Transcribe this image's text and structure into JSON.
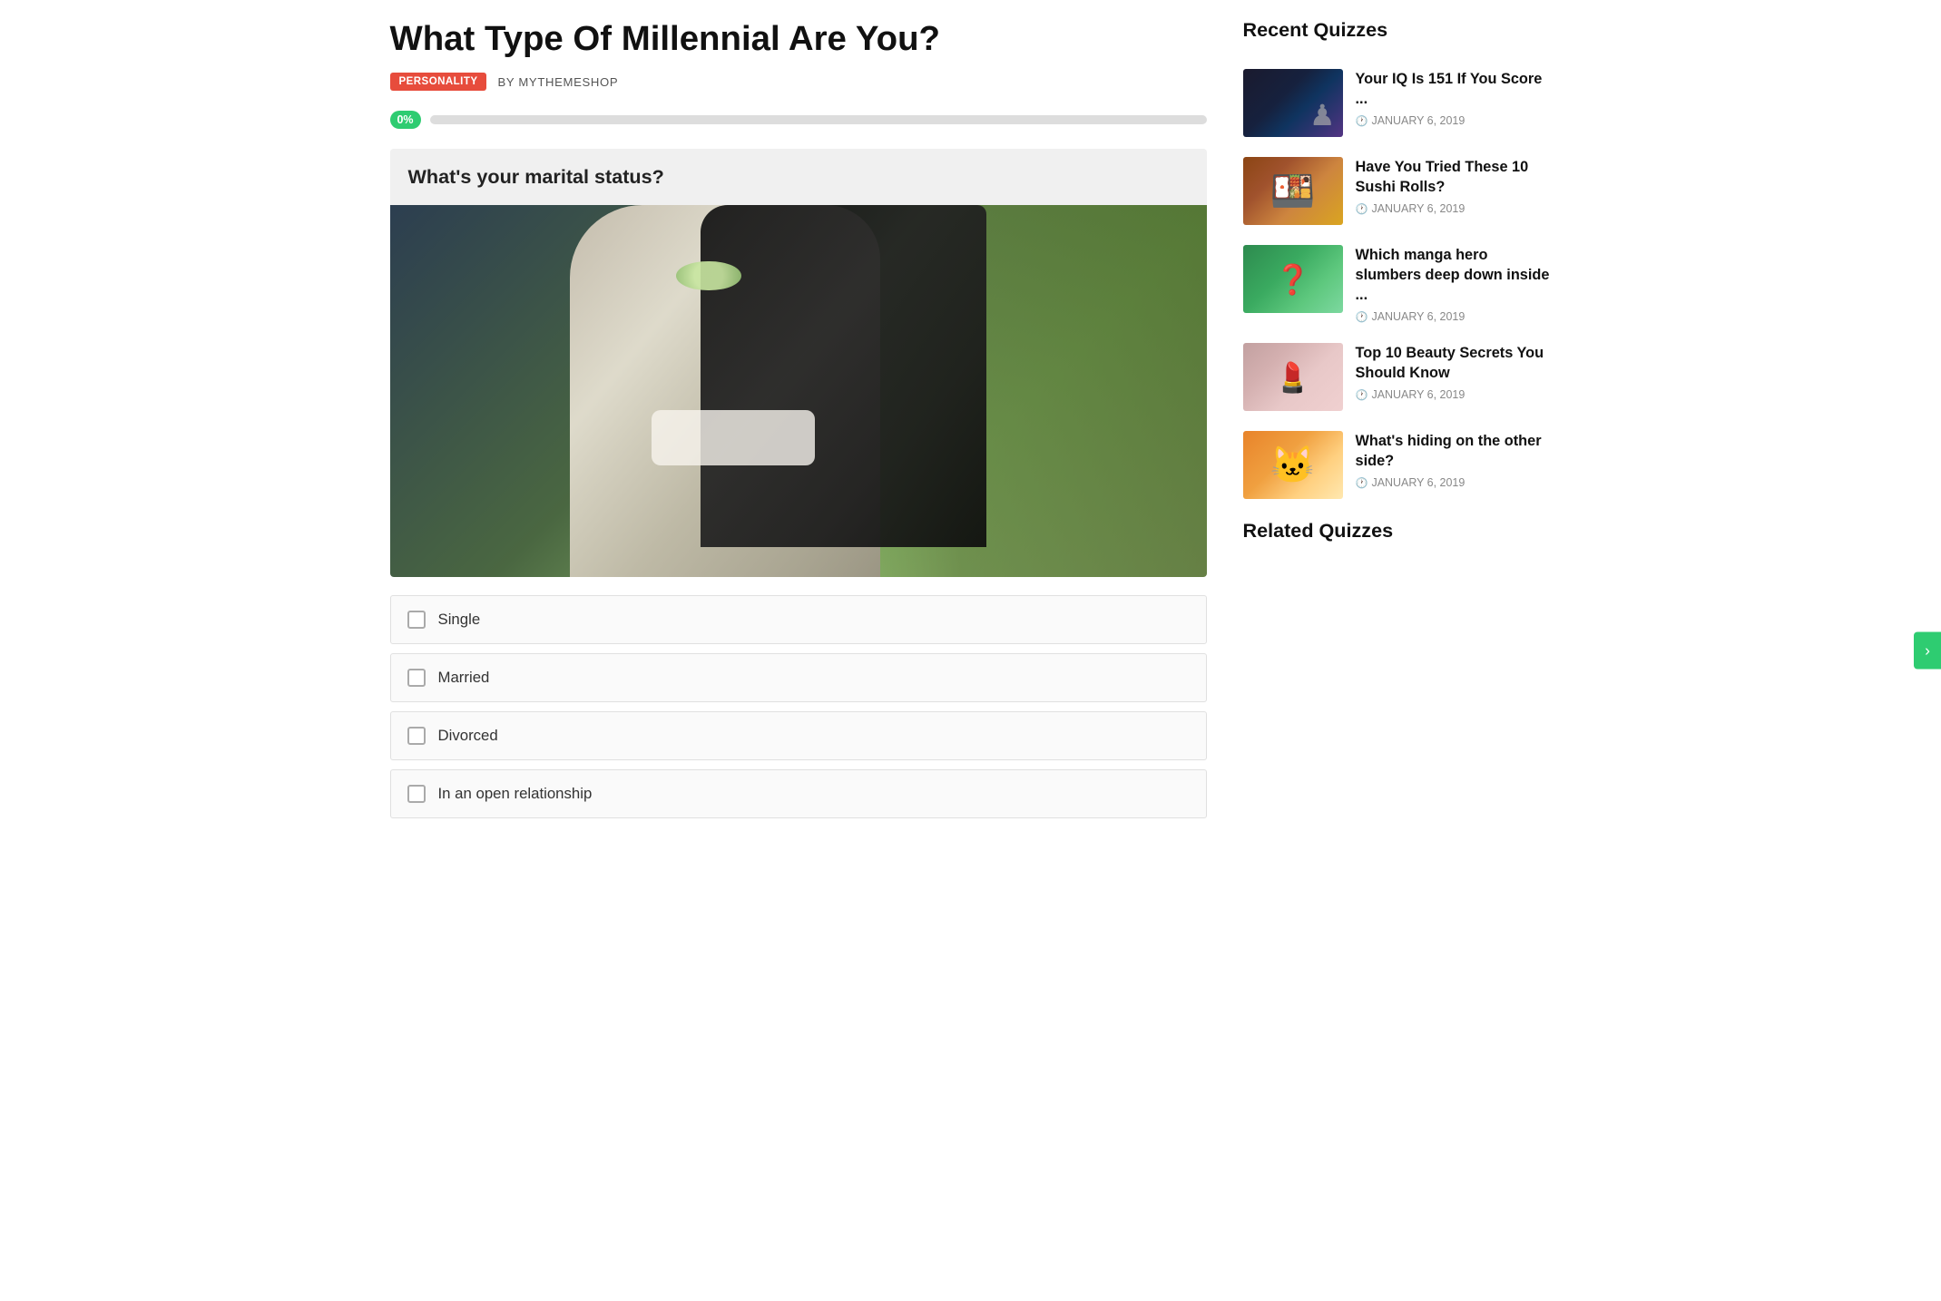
{
  "page": {
    "title": "What Type Of Millennial Are You?",
    "badge": "PERSONALITY",
    "author_prefix": "BY",
    "author": "MYTHEMESHOP",
    "progress": {
      "label": "0%",
      "percent": 0
    }
  },
  "question": {
    "text": "What's your marital status?",
    "answers": [
      {
        "id": "single",
        "label": "Single"
      },
      {
        "id": "married",
        "label": "Married"
      },
      {
        "id": "divorced",
        "label": "Divorced"
      },
      {
        "id": "open",
        "label": "In an open relationship"
      }
    ]
  },
  "sidebar": {
    "recent_title": "Recent Quizzes",
    "related_title": "Related Quizzes",
    "recent_items": [
      {
        "id": "iq",
        "title": "Your IQ Is 151 If You Score ...",
        "date": "JANUARY 6, 2019",
        "thumb_class": "thumb-chess"
      },
      {
        "id": "sushi",
        "title": "Have You Tried These 10 Sushi Rolls?",
        "date": "JANUARY 6, 2019",
        "thumb_class": "thumb-sushi"
      },
      {
        "id": "manga",
        "title": "Which manga hero slumbers deep down inside ...",
        "date": "JANUARY 6, 2019",
        "thumb_class": "thumb-manga"
      },
      {
        "id": "beauty",
        "title": "Top 10 Beauty Secrets You Should Know",
        "date": "JANUARY 6, 2019",
        "thumb_class": "thumb-beauty"
      },
      {
        "id": "cat",
        "title": "What's hiding on the other side?",
        "date": "JANUARY 6, 2019",
        "thumb_class": "thumb-cat"
      }
    ]
  },
  "scroll_hint": "›"
}
